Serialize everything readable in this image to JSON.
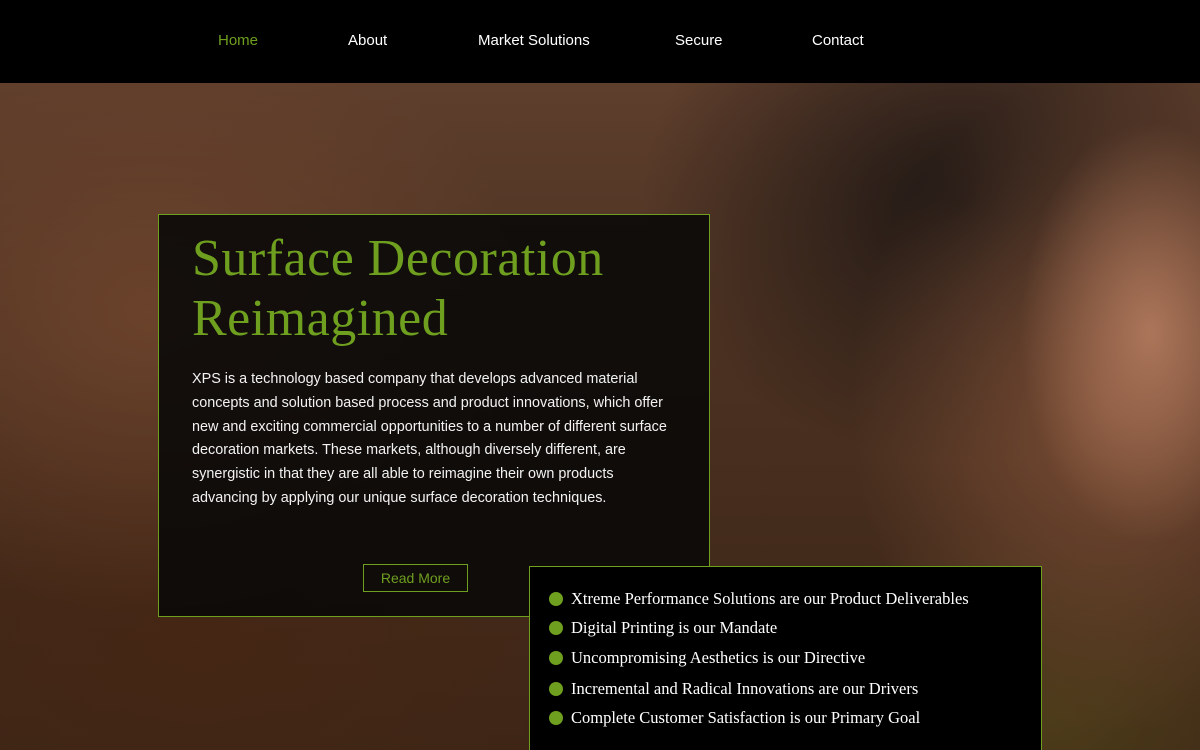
{
  "nav": {
    "items": [
      {
        "label": "Home",
        "active": true
      },
      {
        "label": "About",
        "active": false
      },
      {
        "label": "Market Solutions",
        "active": false
      },
      {
        "label": "Secure",
        "active": false
      },
      {
        "label": "Contact",
        "active": false
      }
    ]
  },
  "hero": {
    "title_line1": "Surface Decoration",
    "title_line2": "Reimagined",
    "body": "XPS is a technology based company that develops advanced material concepts and solution based process and product innovations, which offer new and exciting commercial opportunities to a number of different surface decoration markets. These markets, although diversely different, are synergistic in that they are all able to reimagine their own products advancing by applying our unique surface decoration techniques.",
    "read_more_label": "Read More"
  },
  "values": [
    "Xtreme Performance Solutions are our Product Deliverables",
    "Digital Printing is our Mandate",
    "Uncompromising Aesthetics is our Directive",
    "Incremental and Radical Innovations are our Drivers",
    "Complete Customer Satisfaction is our Primary Goal"
  ],
  "colors": {
    "accent": "#6f9f1f",
    "nav_background": "#000000",
    "card_background": "#080808",
    "text": "#ffffff"
  },
  "icons": {
    "bullet": "green-circle-bullet-icon"
  }
}
